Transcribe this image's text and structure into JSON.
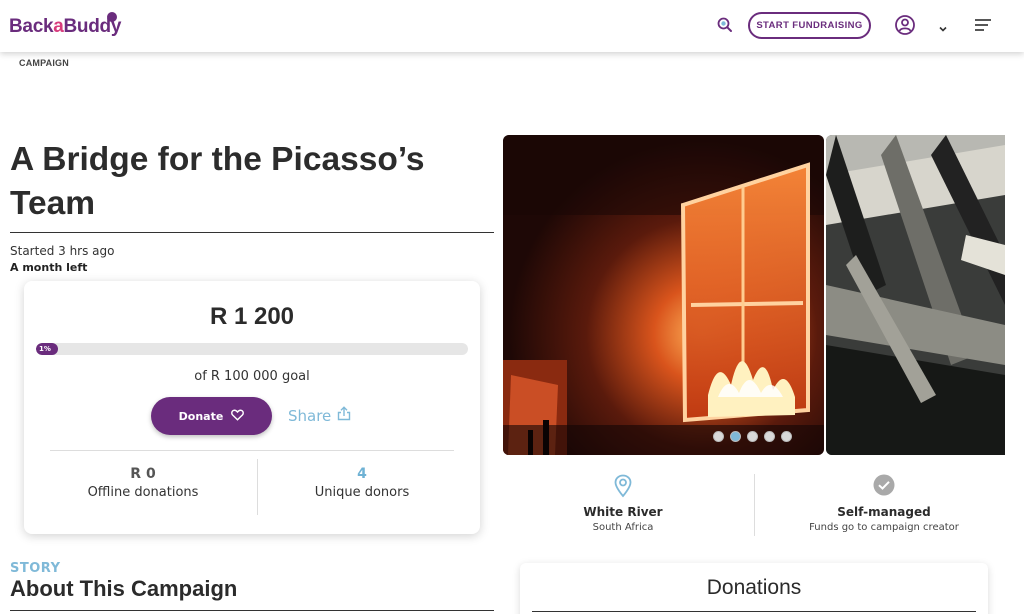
{
  "header": {
    "logo_part1": "Back",
    "logo_part2": "a",
    "logo_part3": "Buddy",
    "start_fundraising": "START FUNDRAISING",
    "icons": [
      "search-icon",
      "user-icon",
      "chevron-down-icon",
      "menu-icon"
    ]
  },
  "breadcrumb": "CAMPAIGN",
  "campaign": {
    "title": "A Bridge for the Picasso’s Team",
    "started": "Started 3 hrs ago",
    "time_left": "A month left"
  },
  "card": {
    "raised": "R 1 200",
    "progress_label": "1%",
    "progress_fraction": 0.01,
    "goal": "of R 100 000 goal",
    "donate_label": "Donate",
    "share_label": "Share",
    "offline_amount": "R 0",
    "offline_label": "Offline donations",
    "donors_count": "4",
    "donors_label": "Unique donors"
  },
  "story": {
    "kicker": "STORY",
    "title": "About This Campaign"
  },
  "gallery": {
    "slide_count": 5,
    "active_slide": 1
  },
  "location": {
    "city": "White River",
    "country": "South Africa"
  },
  "management": {
    "title": "Self-managed",
    "subtitle": "Funds go to campaign creator"
  },
  "donations": {
    "title": "Donations"
  },
  "colors": {
    "brand_purple": "#6a2c7d",
    "accent_blue": "#7fb9d8"
  }
}
